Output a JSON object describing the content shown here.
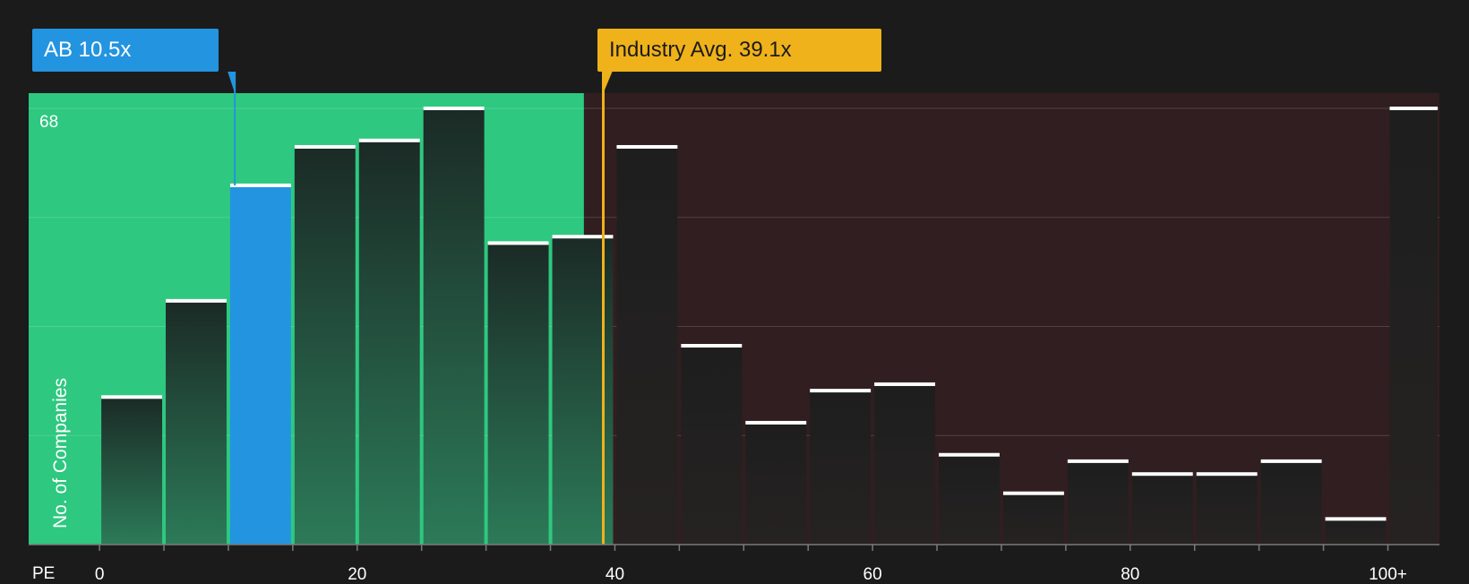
{
  "chart_data": {
    "type": "bar",
    "xlabel": "PE",
    "ylabel": "No. of Companies",
    "ymax_label": "68",
    "ylim": [
      0,
      68
    ],
    "xlim": [
      -5.5,
      104
    ],
    "x_ticks": [
      {
        "value": 0,
        "label": "0"
      },
      {
        "value": 20,
        "label": "20"
      },
      {
        "value": 40,
        "label": "40"
      },
      {
        "value": 60,
        "label": "60"
      },
      {
        "value": 80,
        "label": "80"
      },
      {
        "value": 100,
        "label": "100+"
      }
    ],
    "bins": [
      {
        "start": 0,
        "end": 5,
        "value": 23
      },
      {
        "start": 5,
        "end": 10,
        "value": 38
      },
      {
        "start": 10,
        "end": 15,
        "value": 56,
        "highlight": true
      },
      {
        "start": 15,
        "end": 20,
        "value": 62
      },
      {
        "start": 20,
        "end": 25,
        "value": 63
      },
      {
        "start": 25,
        "end": 30,
        "value": 68
      },
      {
        "start": 30,
        "end": 35,
        "value": 47
      },
      {
        "start": 35,
        "end": 40,
        "value": 48
      },
      {
        "start": 40,
        "end": 45,
        "value": 62
      },
      {
        "start": 45,
        "end": 50,
        "value": 31
      },
      {
        "start": 50,
        "end": 55,
        "value": 19
      },
      {
        "start": 55,
        "end": 60,
        "value": 24
      },
      {
        "start": 60,
        "end": 65,
        "value": 25
      },
      {
        "start": 65,
        "end": 70,
        "value": 14
      },
      {
        "start": 70,
        "end": 75,
        "value": 8
      },
      {
        "start": 75,
        "end": 80,
        "value": 13
      },
      {
        "start": 80,
        "end": 85,
        "value": 11
      },
      {
        "start": 85,
        "end": 90,
        "value": 11
      },
      {
        "start": 90,
        "end": 95,
        "value": 13
      },
      {
        "start": 95,
        "end": 100,
        "value": 4
      },
      {
        "start": 100,
        "end": 104,
        "value": 68
      }
    ],
    "company": {
      "label": "AB 10.5x",
      "value": 10.5,
      "color": "#2394e0"
    },
    "industry": {
      "label": "Industry Avg. 39.1x",
      "value": 39.1,
      "color": "#f0b21a"
    },
    "colors": {
      "background": "#1b1b1b",
      "undervalued_zone": "#2ec880",
      "overvalued_zone": "#311e20",
      "bar_highlight": "#2394e0",
      "bar_top": "#ffffff",
      "gridline": "#4a4a4a"
    },
    "grid": true
  }
}
